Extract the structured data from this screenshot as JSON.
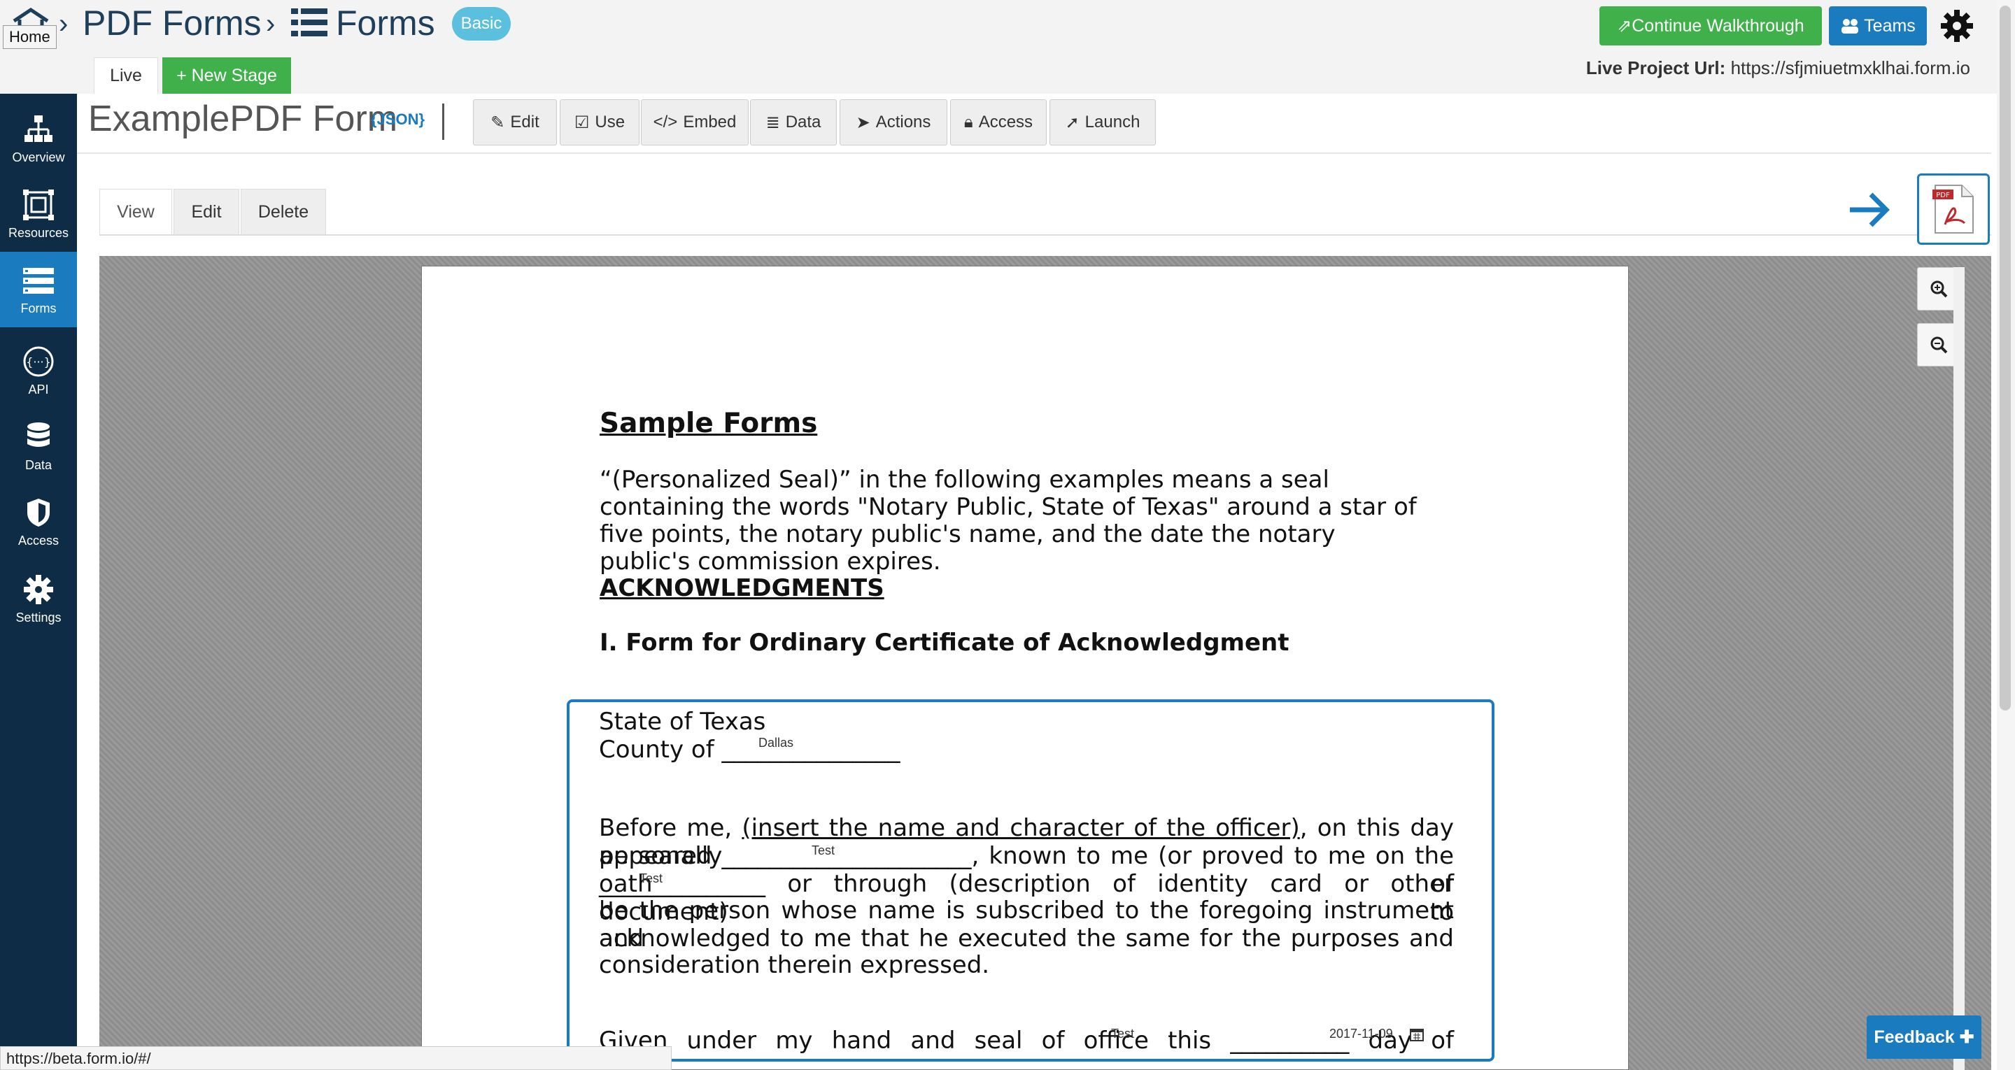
{
  "top": {
    "home_label": "Home",
    "breadcrumb": [
      "PDF Forms",
      "Forms"
    ],
    "plan_badge": "Basic",
    "walkthrough_label": "Continue Walkthrough",
    "teams_label": "Teams",
    "live_url_label": "Live Project Url:",
    "live_url_value": "https://sfjmiuetmxklhai.form.io",
    "stage_live": "Live",
    "stage_new": "+ New Stage"
  },
  "sidebar": {
    "items": [
      {
        "label": "Overview",
        "icon": "sitemap-icon"
      },
      {
        "label": "Resources",
        "icon": "resources-icon"
      },
      {
        "label": "Forms",
        "icon": "forms-icon"
      },
      {
        "label": "API",
        "icon": "api-icon"
      },
      {
        "label": "Data",
        "icon": "database-icon"
      },
      {
        "label": "Access",
        "icon": "shield-icon"
      },
      {
        "label": "Settings",
        "icon": "gear-icon"
      }
    ]
  },
  "form": {
    "title": "ExamplePDF Form",
    "json_tag": "{JSON}",
    "actions": [
      "Edit",
      "Use",
      "Embed",
      "Data",
      "Actions",
      "Access",
      "Launch"
    ],
    "view_tabs": [
      "View",
      "Edit",
      "Delete"
    ]
  },
  "document": {
    "heading": "Sample Forms",
    "intro": "“(Personalized Seal)” in the following examples means a seal containing the words \"Notary Public, State of Texas\" around a star of five points, the notary public's name, and the date the notary public's commission expires.",
    "ack_heading": "ACKNOWLEDGMENTS",
    "form_heading": "I. Form for Ordinary Certificate of Acknowledgment",
    "state_line": "State of Texas",
    "county_label": "County of",
    "county_blank": "_______________",
    "before_me": "Before me,",
    "officer_text": "(insert the name and character of the officer)",
    "day_personally": ", on this day personally",
    "appeared": "appeared",
    "appeared_blank": "_____________________",
    "known_to_me": ", known to me (or proved to me on the oath of",
    "oath_blank": "______________",
    "through_text": "or through (description of identity card or other document) to",
    "line4": "be the person whose name is subscribed to the foregoing instrument and",
    "line5": "acknowledged to me that he executed the same for the purposes and",
    "line6": "consideration therein expressed.",
    "given_under": "Given under my hand and seal of office this",
    "day_blank": "__________",
    "day_of": "day of",
    "date_blank": "__________,",
    "fields": {
      "county": "Dallas",
      "appeared": "Test",
      "oath": "Test",
      "day": "Test",
      "date": "2017-11-09"
    }
  },
  "status_url": "https://beta.form.io/#/",
  "feedback_label": "Feedback"
}
